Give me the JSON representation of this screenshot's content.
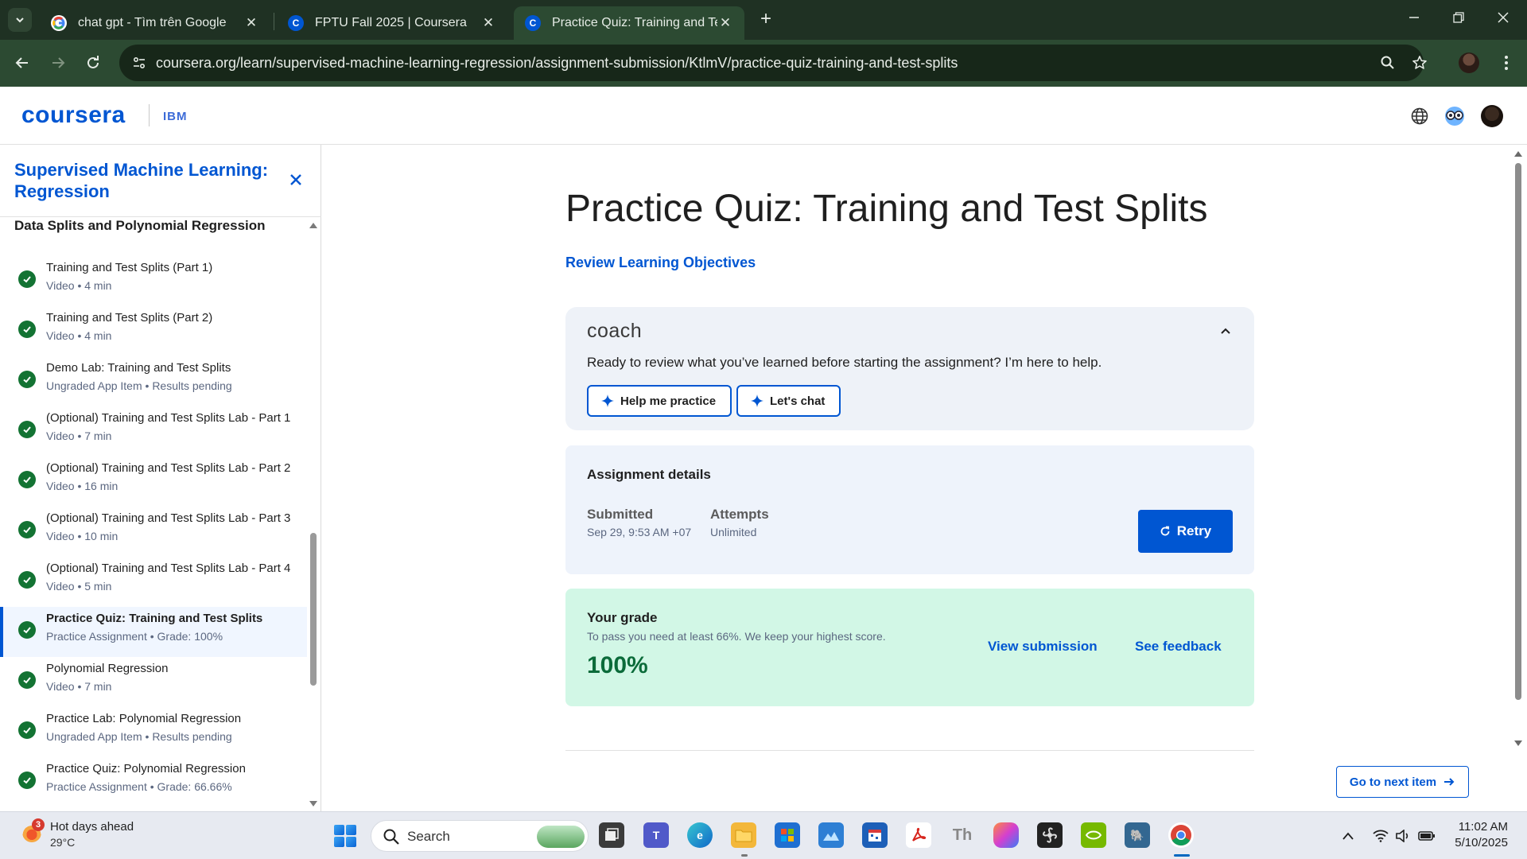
{
  "browser": {
    "tabs": [
      {
        "title": "chat gpt - Tìm trên Google",
        "icon": "google-icon"
      },
      {
        "title": "FPTU Fall 2025 | Coursera",
        "icon": "coursera-icon"
      },
      {
        "title": "Practice Quiz: Training and Test",
        "icon": "coursera-icon"
      }
    ],
    "url": "coursera.org/learn/supervised-machine-learning-regression/assignment-submission/KtlmV/practice-quiz-training-and-test-splits"
  },
  "header": {
    "logo": "coursera",
    "partner": "IBM"
  },
  "sidebar": {
    "course_title": "Supervised Machine Learning: Regression",
    "section_title": "Data Splits and Polynomial Regression",
    "items": [
      {
        "title": "Training and Test Splits (Part 1)",
        "meta": "Video • 4 min",
        "status": "completed"
      },
      {
        "title": "Training and Test Splits (Part 2)",
        "meta": "Video • 4 min",
        "status": "completed"
      },
      {
        "title": "Demo Lab: Training and Test Splits",
        "meta": "Ungraded App Item • Results pending",
        "status": "completed"
      },
      {
        "title": "(Optional) Training and Test Splits Lab - Part 1",
        "meta": "Video • 7 min",
        "status": "completed"
      },
      {
        "title": "(Optional) Training and Test Splits Lab - Part 2",
        "meta": "Video • 16 min",
        "status": "completed"
      },
      {
        "title": "(Optional) Training and Test Splits Lab - Part 3",
        "meta": "Video • 10 min",
        "status": "completed"
      },
      {
        "title": "(Optional) Training and Test Splits Lab - Part 4",
        "meta": "Video • 5 min",
        "status": "completed"
      },
      {
        "title": "Practice Quiz: Training and Test Splits",
        "meta": "Practice Assignment • Grade: 100%",
        "status": "completed",
        "active": true
      },
      {
        "title": "Polynomial Regression",
        "meta": "Video • 7 min",
        "status": "completed"
      },
      {
        "title": "Practice Lab: Polynomial Regression",
        "meta": "Ungraded App Item • Results pending",
        "status": "completed"
      },
      {
        "title": "Practice Quiz: Polynomial Regression",
        "meta": "Practice Assignment • Grade: 66.66%",
        "status": "completed"
      }
    ]
  },
  "main": {
    "title": "Practice Quiz: Training and Test Splits",
    "review_link": "Review Learning Objectives",
    "coach": {
      "logo": "coach",
      "text": "Ready to review what you’ve learned before starting the assignment? I’m here to help.",
      "btn_practice": "Help me practice",
      "btn_chat": "Let's chat"
    },
    "details": {
      "title": "Assignment details",
      "submitted_label": "Submitted",
      "submitted_value": "Sep 29, 9:53 AM +07",
      "attempts_label": "Attempts",
      "attempts_value": "Unlimited",
      "retry": "Retry"
    },
    "grade": {
      "title": "Your grade",
      "note": "To pass you need at least 66%. We keep your highest score.",
      "value": "100%",
      "view_submission": "View submission",
      "see_feedback": "See feedback"
    },
    "next_item": "Go to next item"
  },
  "taskbar": {
    "weather_title": "Hot days ahead",
    "weather_temp": "29°C",
    "weather_badge": "3",
    "search": "Search",
    "time": "11:02 AM",
    "date": "5/10/2025"
  },
  "colors": {
    "brand": "#0056d2",
    "grade_bg": "#d2f7e6",
    "check": "#137333",
    "chrome_bg": "#1f3123"
  }
}
